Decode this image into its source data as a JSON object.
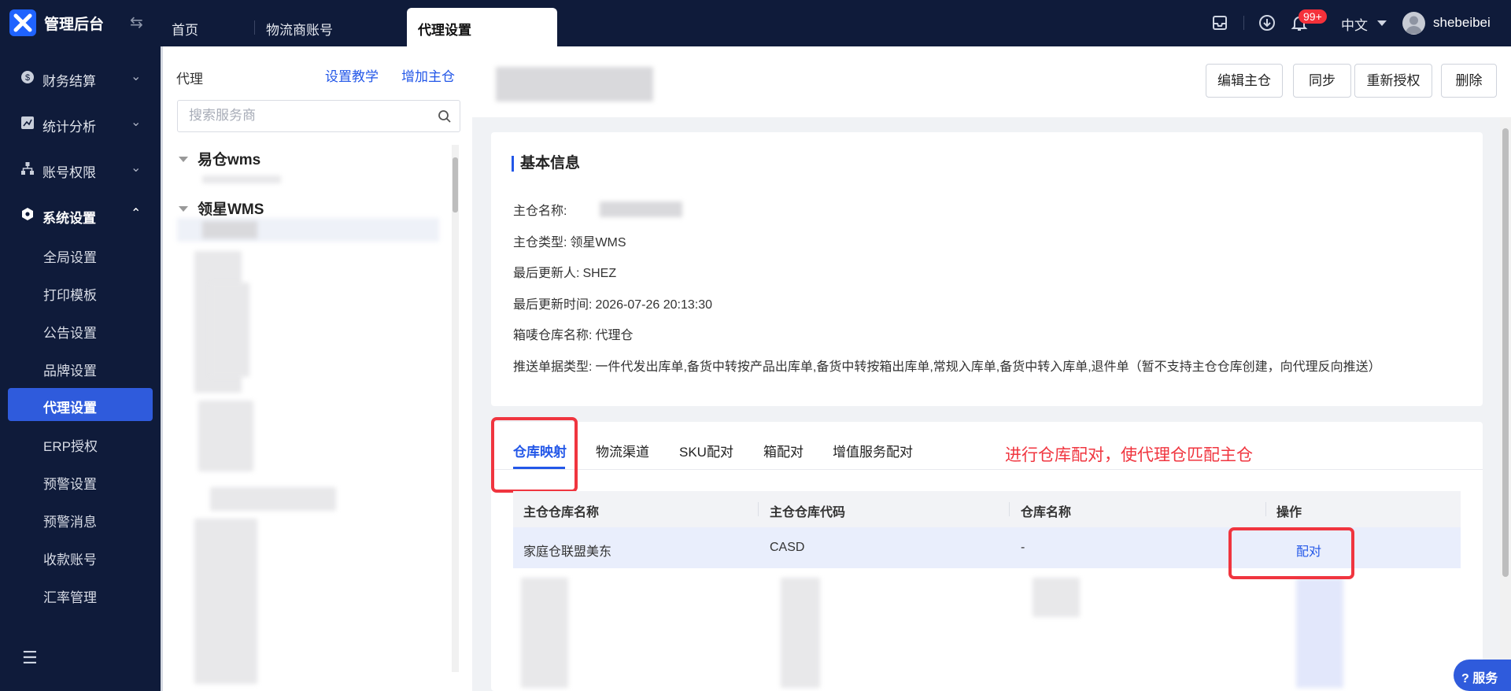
{
  "header": {
    "app_title": "管理后台",
    "tabs": [
      {
        "label": "首页"
      },
      {
        "label": "物流商账号"
      },
      {
        "label": "代理设置"
      }
    ],
    "notification_badge": "99+",
    "language": "中文",
    "username": "shebeibei"
  },
  "sidebar": {
    "groups": [
      {
        "label": "财务结算",
        "icon": "dollar-icon"
      },
      {
        "label": "统计分析",
        "icon": "chart-icon"
      },
      {
        "label": "账号权限",
        "icon": "org-icon"
      },
      {
        "label": "系统设置",
        "icon": "settings-icon"
      }
    ],
    "sub_items": [
      {
        "label": "全局设置"
      },
      {
        "label": "打印模板"
      },
      {
        "label": "公告设置"
      },
      {
        "label": "品牌设置"
      },
      {
        "label": "代理设置"
      },
      {
        "label": "ERP授权"
      },
      {
        "label": "预警设置"
      },
      {
        "label": "预警消息"
      },
      {
        "label": "收款账号"
      },
      {
        "label": "汇率管理"
      }
    ]
  },
  "left_panel": {
    "title": "代理",
    "tutorial_link": "设置教学",
    "add_link": "增加主仓",
    "search_placeholder": "搜索服务商",
    "tree": [
      {
        "label": "易仓wms"
      },
      {
        "label": "领星WMS"
      }
    ]
  },
  "actions": {
    "edit": "编辑主仓",
    "sync": "同步",
    "reauth": "重新授权",
    "delete": "删除"
  },
  "basic_info": {
    "title": "基本信息",
    "rows": [
      {
        "label": "主仓名称:",
        "value": ""
      },
      {
        "label": "主仓类型:",
        "value": "领星WMS"
      },
      {
        "label": "最后更新人:",
        "value": "SHEZ"
      },
      {
        "label": "最后更新时间:",
        "value": "2026-07-26 20:13:30"
      },
      {
        "label": "箱唛仓库名称:",
        "value": "代理仓"
      },
      {
        "label": "推送单据类型:",
        "value": "一件代发出库单,备货中转按产品出库单,备货中转按箱出库单,常规入库单,备货中转入库单,退件单（暂不支持主仓仓库创建，向代理反向推送）"
      }
    ]
  },
  "detail_tabs": [
    {
      "label": "仓库映射"
    },
    {
      "label": "物流渠道"
    },
    {
      "label": "SKU配对"
    },
    {
      "label": "箱配对"
    },
    {
      "label": "增值服务配对"
    }
  ],
  "annotation": "进行仓库配对，使代理仓匹配主仓",
  "table": {
    "columns": [
      "主仓仓库名称",
      "主仓仓库代码",
      "仓库名称",
      "操作"
    ],
    "rows": [
      {
        "name": "家庭仓联盟美东",
        "code": "CASD",
        "warehouse": "-",
        "action": "配对"
      }
    ]
  },
  "service_button": "服务",
  "colors": {
    "nav_bg": "#0f1b3a",
    "accent": "#2357e8",
    "annotation_red": "#f0353f"
  }
}
